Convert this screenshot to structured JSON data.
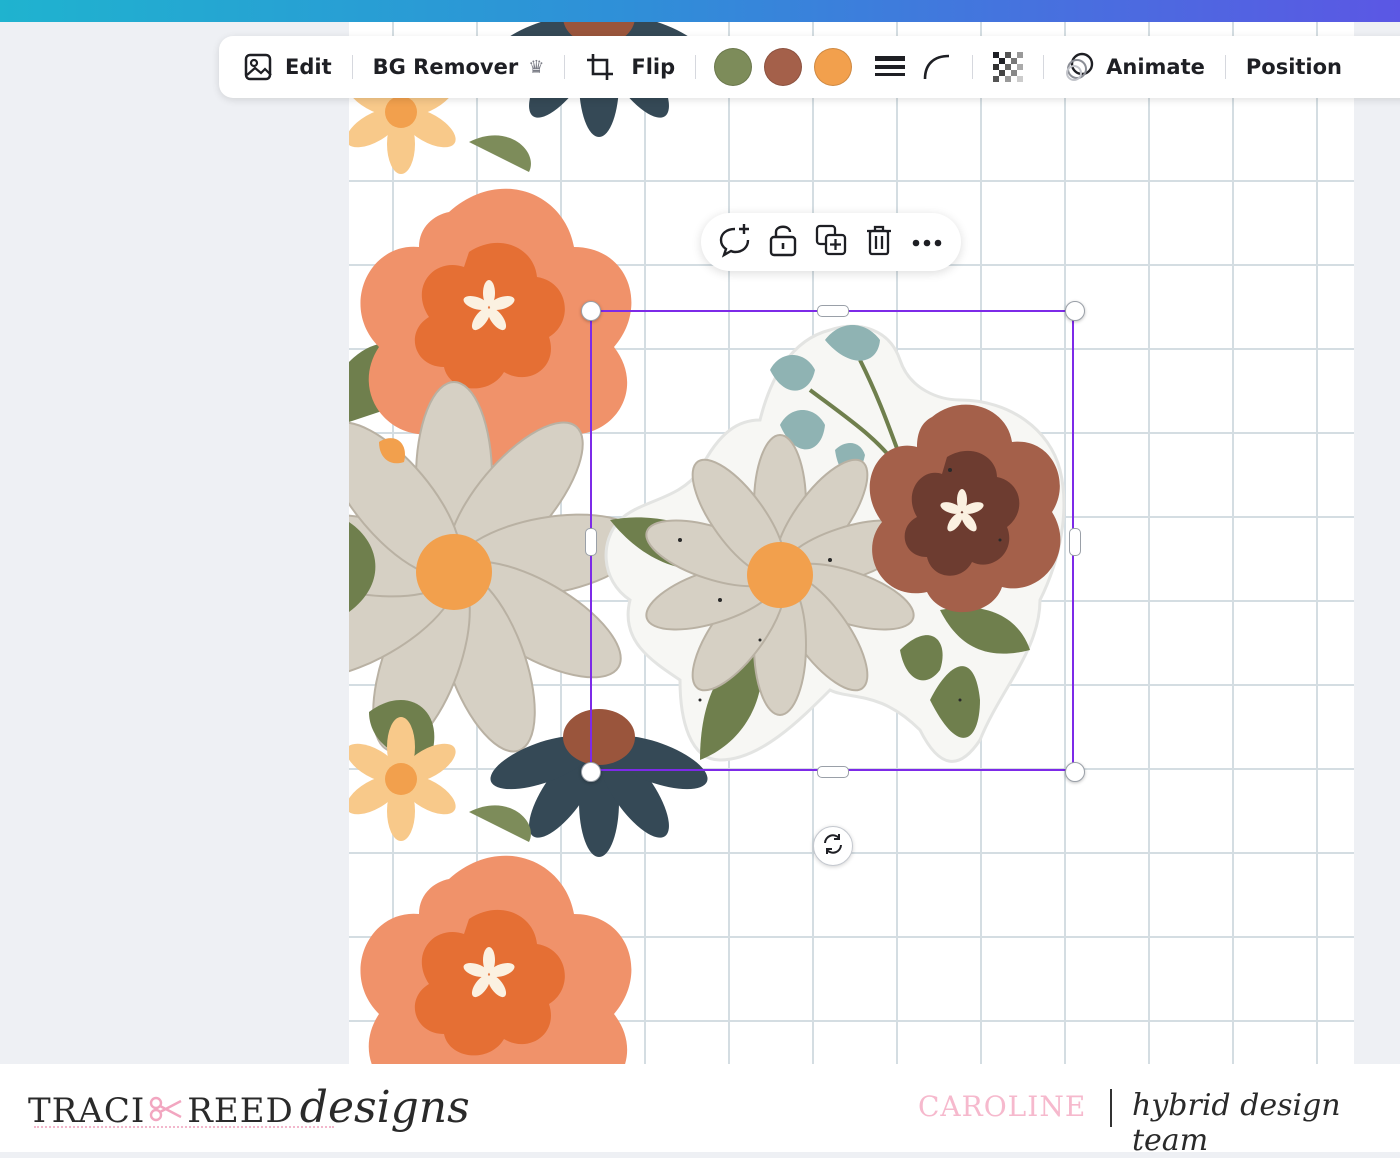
{
  "toolbar": {
    "edit_label": "Edit",
    "bg_remover_label": "BG Remover",
    "flip_label": "Flip",
    "animate_label": "Animate",
    "position_label": "Position",
    "colors": [
      "#7d8c5a",
      "#a4604a",
      "#f2a04d"
    ]
  },
  "floating_actions": [
    "comment-add",
    "unlock",
    "duplicate",
    "delete",
    "more"
  ],
  "footer": {
    "brand_left": "TRACI",
    "brand_right": "REED",
    "brand_script": "designs",
    "designer_name": "CAROLINE",
    "team_label": "hybrid design team"
  },
  "accent": {
    "selection": "#7d2ae8",
    "brand_pink": "#f6b9cd"
  }
}
